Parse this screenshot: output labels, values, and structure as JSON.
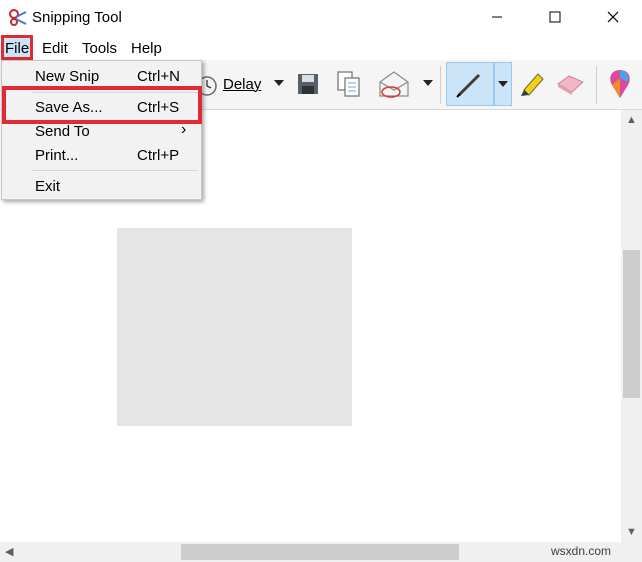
{
  "window": {
    "title": "Snipping Tool",
    "minimize_icon": "minimize-icon",
    "maximize_icon": "maximize-icon",
    "close_icon": "close-icon"
  },
  "menubar": {
    "file": "File",
    "edit": "Edit",
    "tools": "Tools",
    "help": "Help"
  },
  "toolbar": {
    "delay_label": "Delay"
  },
  "file_menu": {
    "items": [
      {
        "label": "New Snip",
        "shortcut": "Ctrl+N"
      },
      {
        "label": "Save As...",
        "shortcut": "Ctrl+S"
      },
      {
        "label": "Send To",
        "shortcut": ""
      },
      {
        "label": "Print...",
        "shortcut": "Ctrl+P"
      },
      {
        "label": "Exit",
        "shortcut": ""
      }
    ],
    "submenu_arrow": "›"
  },
  "watermark": "wsxdn.com",
  "colors": {
    "highlight_border": "#e02b35",
    "file_active_bg": "#cce4f7",
    "pen_active_bg": "#cce4f7",
    "menu_bg": "#f2f2f2"
  }
}
